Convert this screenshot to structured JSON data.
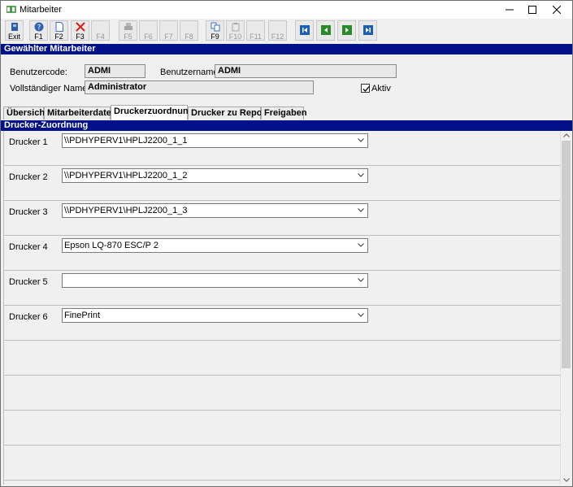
{
  "window": {
    "title": "Mitarbeiter"
  },
  "toolbar": {
    "buttons": [
      {
        "label": "Exit",
        "icon": "exit-icon"
      },
      {
        "label": "F1",
        "icon": "help-icon"
      },
      {
        "label": "F2",
        "icon": "new-document-icon"
      },
      {
        "label": "F3",
        "icon": "delete-icon"
      },
      {
        "label": "F4",
        "icon": "blank-icon"
      },
      {
        "label": "F5",
        "icon": "print-icon"
      },
      {
        "label": "F6",
        "icon": "blank-icon"
      },
      {
        "label": "F7",
        "icon": "blank-icon"
      },
      {
        "label": "F8",
        "icon": "blank-icon"
      },
      {
        "label": "F9",
        "icon": "copy-icon"
      },
      {
        "label": "F10",
        "icon": "paste-icon"
      },
      {
        "label": "F11",
        "icon": "blank-icon"
      },
      {
        "label": "F12",
        "icon": "blank-icon"
      }
    ],
    "nav": [
      "first-record-icon",
      "previous-record-icon",
      "next-record-icon",
      "last-record-icon"
    ]
  },
  "header": {
    "title": "Gewählter Mitarbeiter",
    "user_code_label": "Benutzercode:",
    "user_code_value": "ADMI",
    "user_name_label": "Benutzername:",
    "user_name_value": "ADMI",
    "full_name_label": "Vollständiger Name:",
    "full_name_value": "Administrator",
    "active_label": "Aktiv",
    "active_checked": true
  },
  "tabs": [
    {
      "label": "Übersicht"
    },
    {
      "label": "Mitarbeiterdaten"
    },
    {
      "label": "Druckerzuordnung"
    },
    {
      "label": "Drucker zu Report"
    },
    {
      "label": "Freigaben"
    }
  ],
  "active_tab": "Druckerzuordnung",
  "printer_section": {
    "title": "Drucker-Zuordnung",
    "rows": [
      {
        "label": "Drucker 1",
        "value": "\\\\PDHYPERV1\\HPLJ2200_1_1"
      },
      {
        "label": "Drucker 2",
        "value": "\\\\PDHYPERV1\\HPLJ2200_1_2"
      },
      {
        "label": "Drucker 3",
        "value": "\\\\PDHYPERV1\\HPLJ2200_1_3"
      },
      {
        "label": "Drucker 4",
        "value": "Epson LQ-870 ESC/P 2"
      },
      {
        "label": "Drucker 5",
        "value": ""
      },
      {
        "label": "Drucker 6",
        "value": "FinePrint"
      }
    ]
  },
  "colors": {
    "section_header": "#00118a",
    "accent_nav": "#1a5fb4"
  }
}
